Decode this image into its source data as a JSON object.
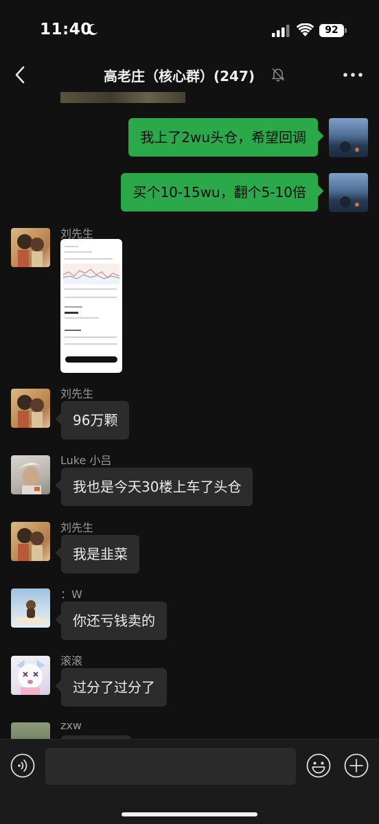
{
  "status_bar": {
    "time": "11:40",
    "battery": "92"
  },
  "header": {
    "title": "高老庄（核心群）(247)"
  },
  "messages": [
    {
      "sender": "",
      "text": "我上了2wu头仓，希望回调",
      "outgoing": true
    },
    {
      "sender": "",
      "text": "买个10-15wu，翻个5-10倍",
      "outgoing": true
    },
    {
      "sender": "刘先生",
      "text": "",
      "type": "image"
    },
    {
      "sender": "刘先生",
      "text": "96万颗"
    },
    {
      "sender": "Luke 小吕",
      "text": "我也是今天30楼上车了头仓"
    },
    {
      "sender": "刘先生",
      "text": "我是韭菜"
    },
    {
      "sender": "：W",
      "text": "你还亏钱卖的"
    },
    {
      "sender": "滚滚",
      "text": "过分了过分了"
    },
    {
      "sender": "zxw",
      "text": ""
    }
  ],
  "colors": {
    "background": "#111111",
    "outgoing_bubble": "#2ba84a",
    "incoming_bubble": "#2c2c2c"
  },
  "icons": {
    "back": "chevron-left-icon",
    "mute": "bell-off-icon",
    "more": "more-horizontal-icon",
    "voice": "voice-icon",
    "emoji": "emoji-icon",
    "plus": "plus-icon"
  }
}
